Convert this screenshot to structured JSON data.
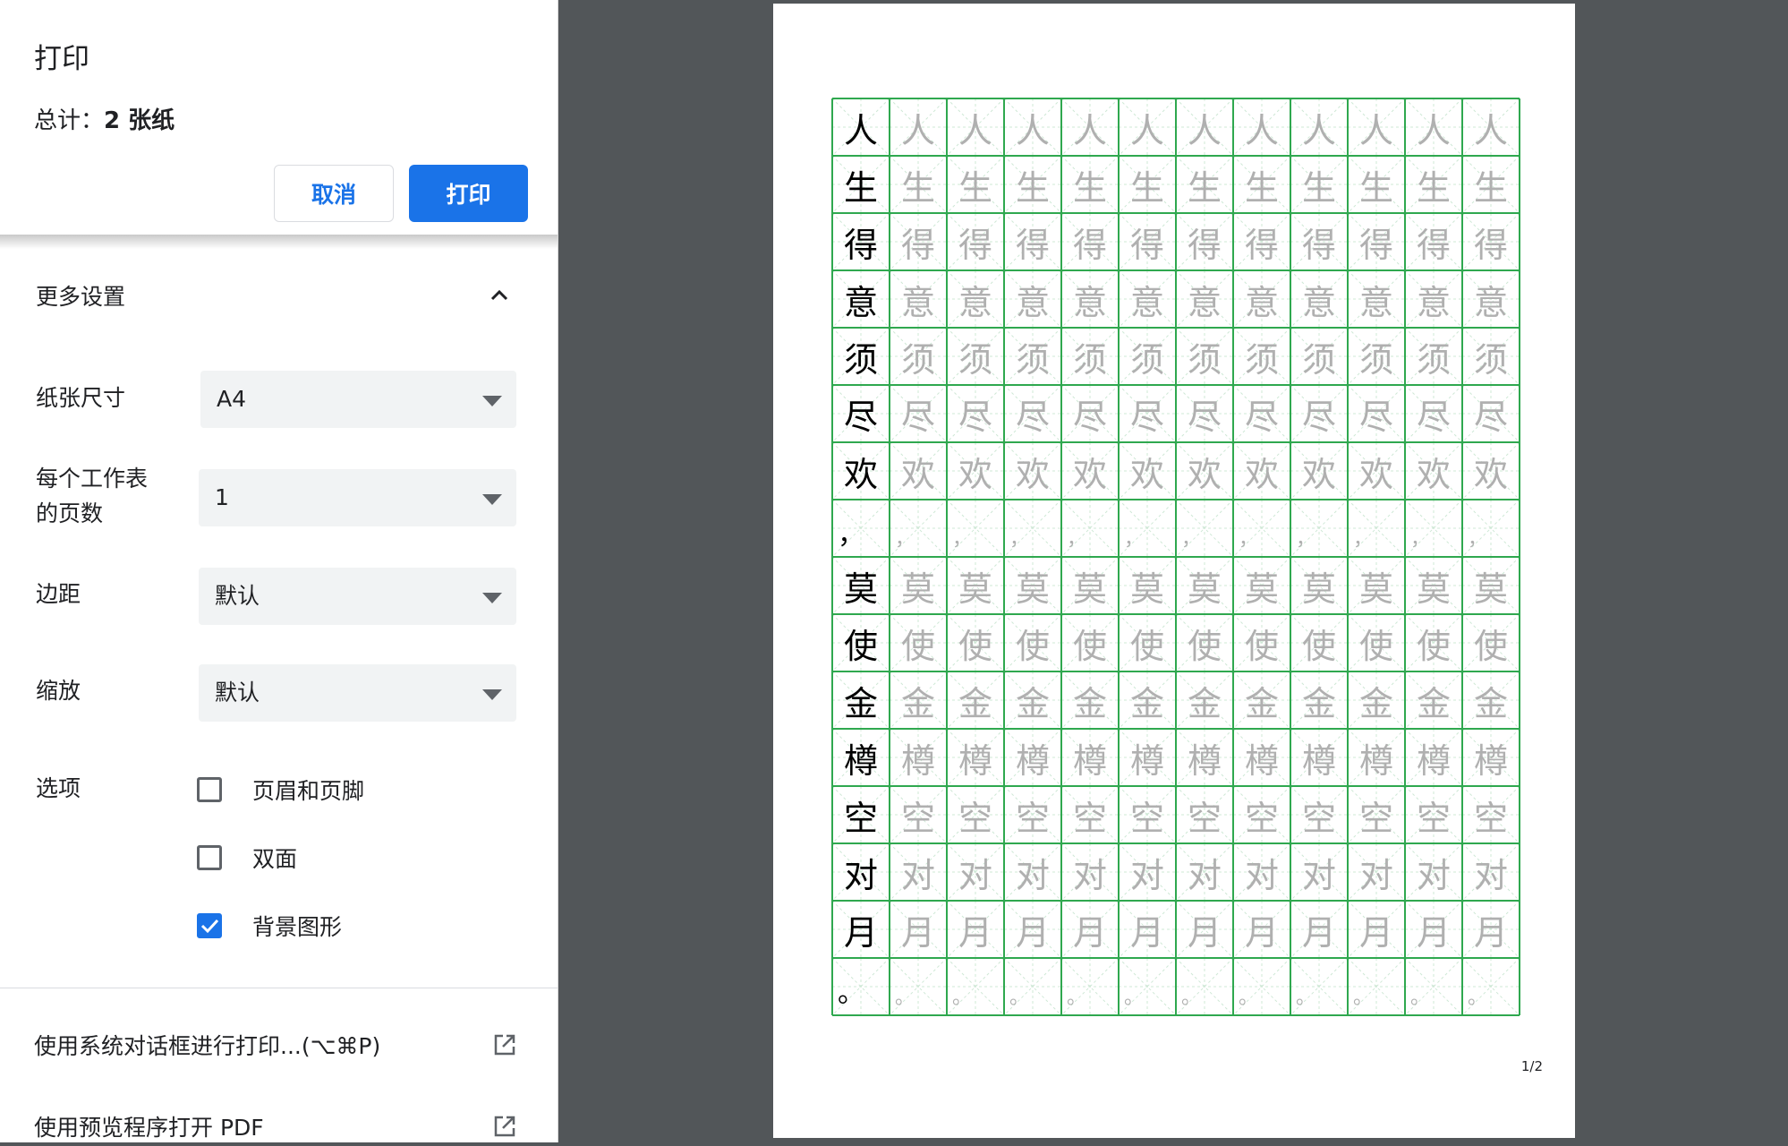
{
  "panel": {
    "title": "打印",
    "total_prefix": "总计：",
    "total_value": "2 张纸",
    "cancel_label": "取消",
    "print_label": "打印",
    "more_settings_label": "更多设置",
    "paper_size": {
      "label": "纸张尺寸",
      "value": "A4"
    },
    "pages_per_sheet": {
      "label_line1": "每个工作表",
      "label_line2": "的页数",
      "value": "1"
    },
    "margins": {
      "label": "边距",
      "value": "默认"
    },
    "scale": {
      "label": "缩放",
      "value": "默认"
    },
    "options": {
      "label": "选项",
      "headers_footers": {
        "label": "页眉和页脚",
        "checked": false
      },
      "duplex": {
        "label": "双面",
        "checked": false
      },
      "background_graphics": {
        "label": "背景图形",
        "checked": true
      }
    },
    "system_dialog_link": "使用系统对话框进行打印...(⌥⌘P)",
    "open_pdf_link": "使用预览程序打开 PDF"
  },
  "preview": {
    "characters": [
      "人",
      "生",
      "得",
      "意",
      "须",
      "尽",
      "欢",
      "，",
      "莫",
      "使",
      "金",
      "樽",
      "空",
      "对",
      "月",
      "。"
    ],
    "columns": 12,
    "page_number": "1/2",
    "grid_color": "#2fa84f",
    "guide_color": "#cfe8d6",
    "trace_color": "#b0b0b0"
  },
  "colors": {
    "accent": "#1a73e8",
    "backdrop": "#525659"
  }
}
